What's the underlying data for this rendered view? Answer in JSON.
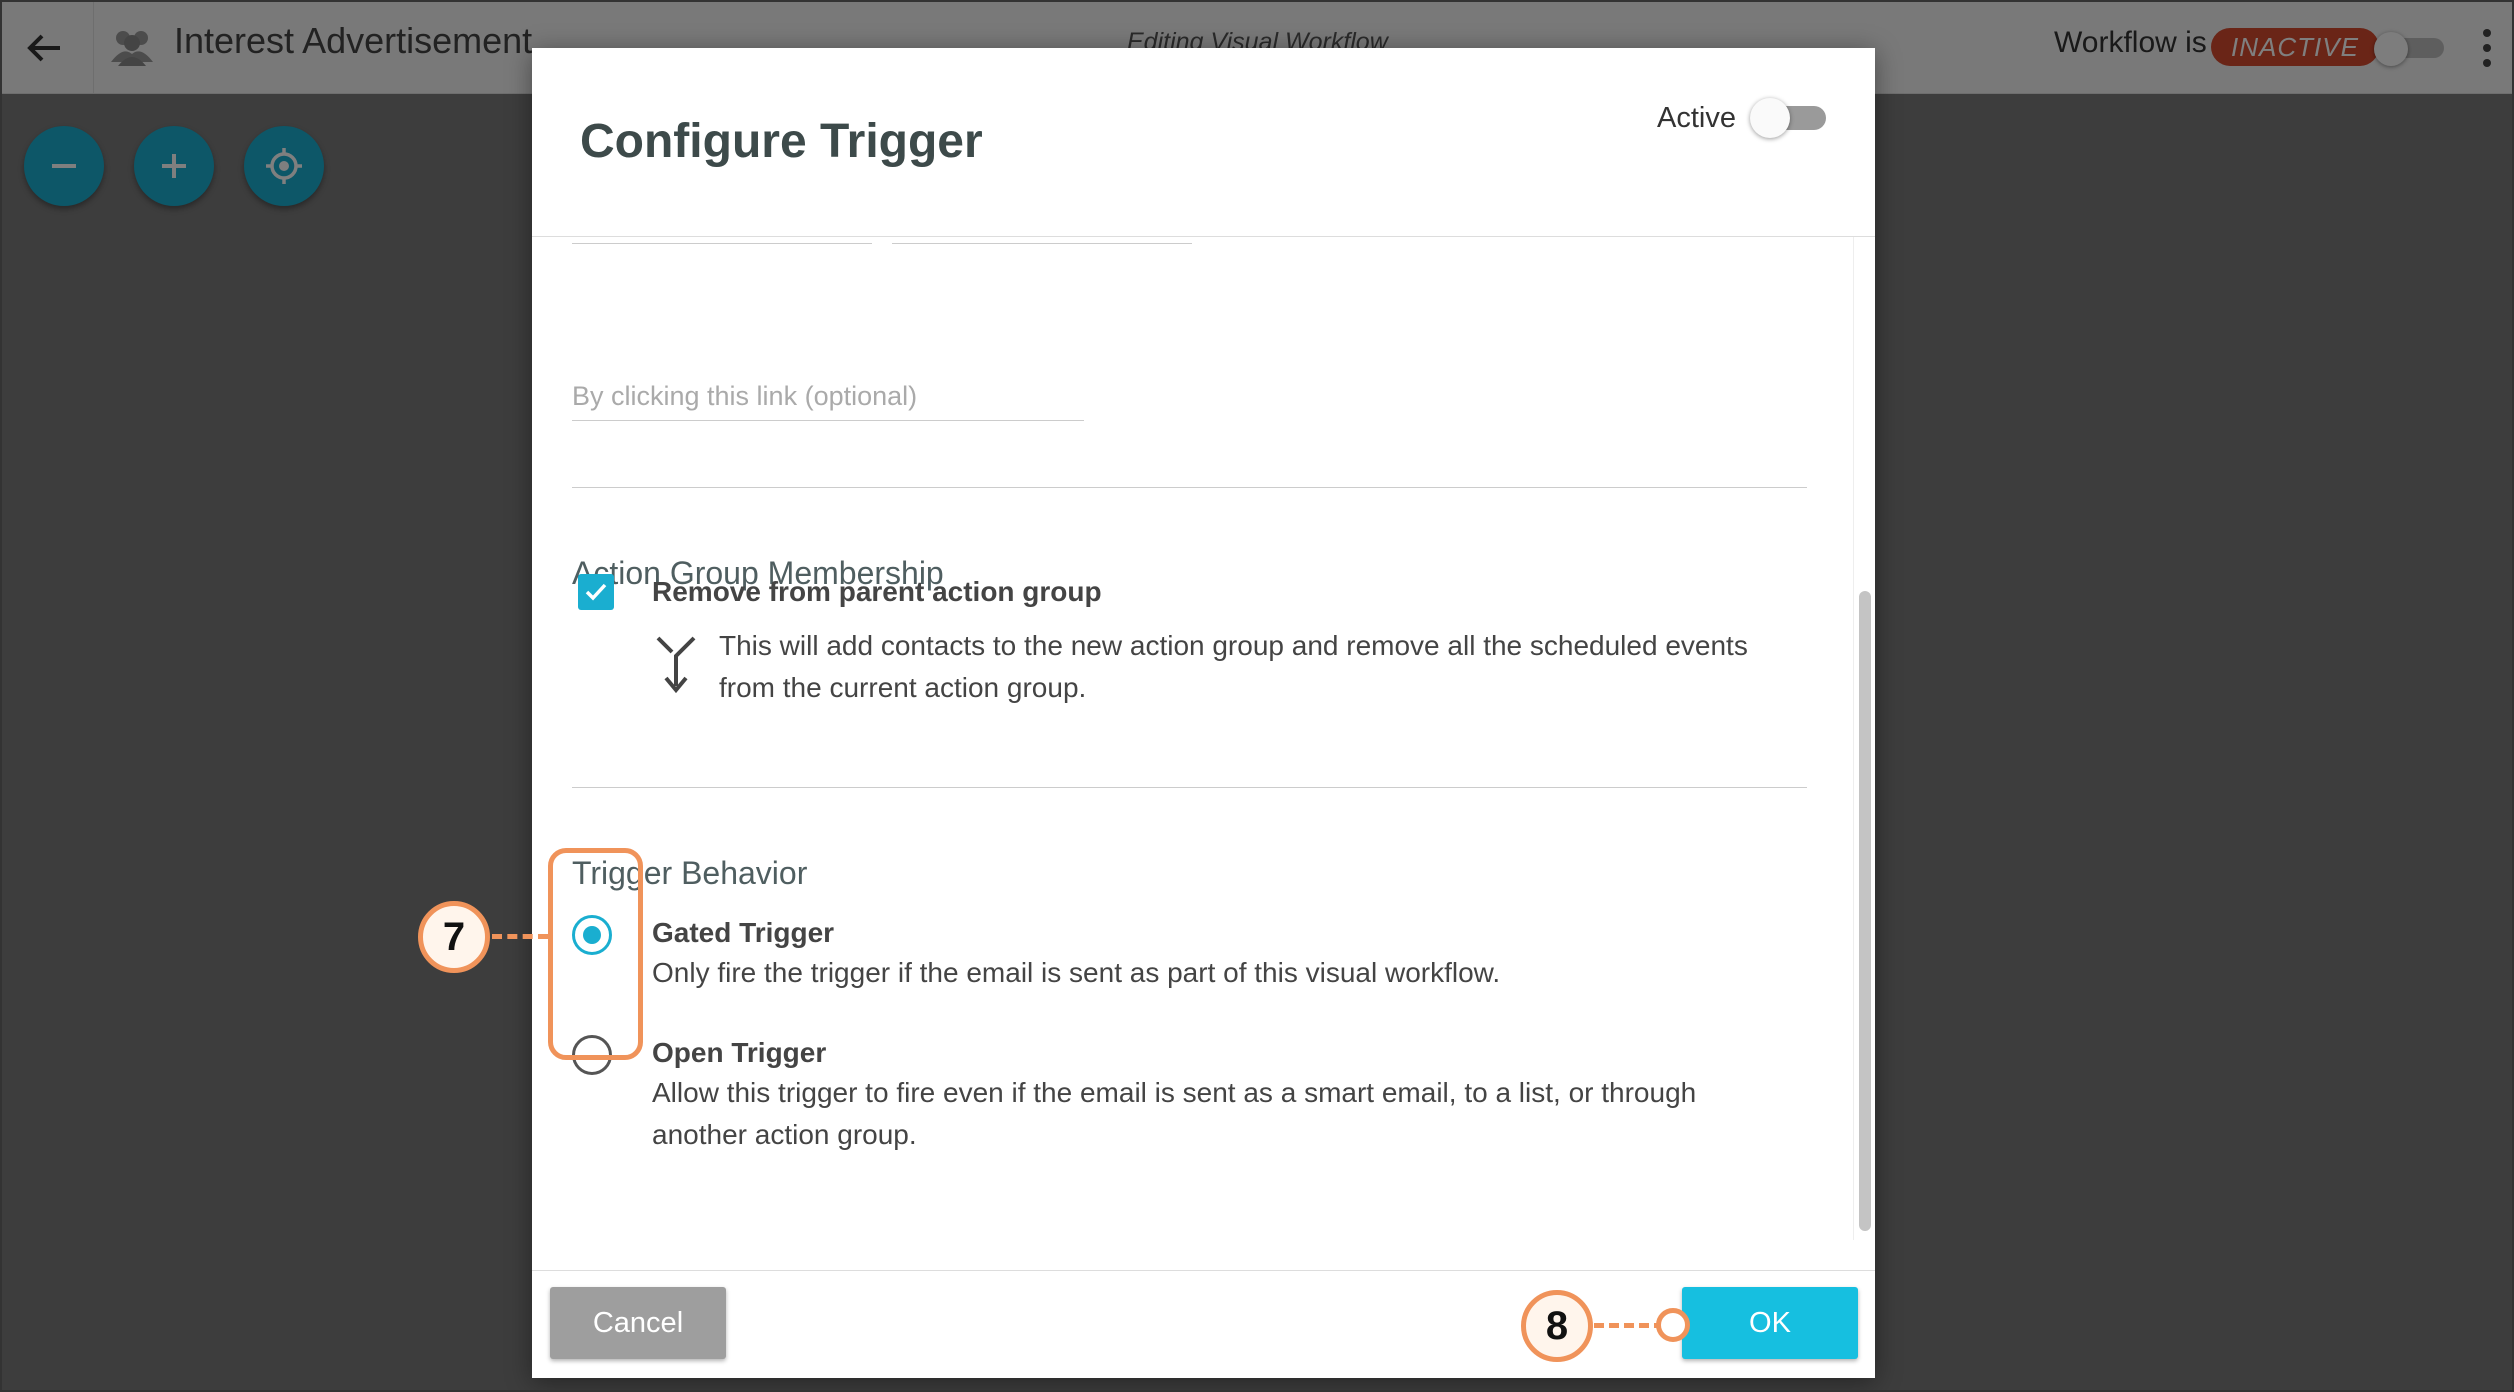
{
  "app": {
    "title": "Interest Advertisement",
    "editing_label": "Editing Visual Workflow",
    "workflow_label": "Workflow is",
    "workflow_status": "INACTIVE"
  },
  "icons": {
    "back": "arrow-left-icon",
    "group": "group-icon",
    "more": "kebab-icon",
    "zoom_out": "minus-icon",
    "zoom_in": "plus-icon",
    "recenter": "target-icon",
    "merge": "merge-arrow-icon"
  },
  "modal": {
    "title": "Configure Trigger",
    "active_label": "Active",
    "link_placeholder": "By clicking this link (optional)",
    "action_group": {
      "title": "Action Group Membership",
      "checkbox_label": "Remove from parent action group",
      "checked": true,
      "description": "This will add contacts to the new action group and remove all the scheduled events from the current action group."
    },
    "trigger_behavior": {
      "title": "Trigger Behavior",
      "options": [
        {
          "label": "Gated Trigger",
          "description": "Only fire the trigger if the email is sent as part of this visual workflow.",
          "selected": true
        },
        {
          "label": "Open Trigger",
          "description": "Allow this trigger to fire even if the email is sent as a smart email, to a list, or through another action group.",
          "selected": false
        }
      ]
    },
    "cancel_label": "Cancel",
    "ok_label": "OK"
  },
  "callouts": [
    "7",
    "8"
  ],
  "colors": {
    "accent": "#1aaed0",
    "ok_button": "#16bfe0",
    "inactive_badge": "#d54a2e",
    "callout": "#f0935a"
  }
}
